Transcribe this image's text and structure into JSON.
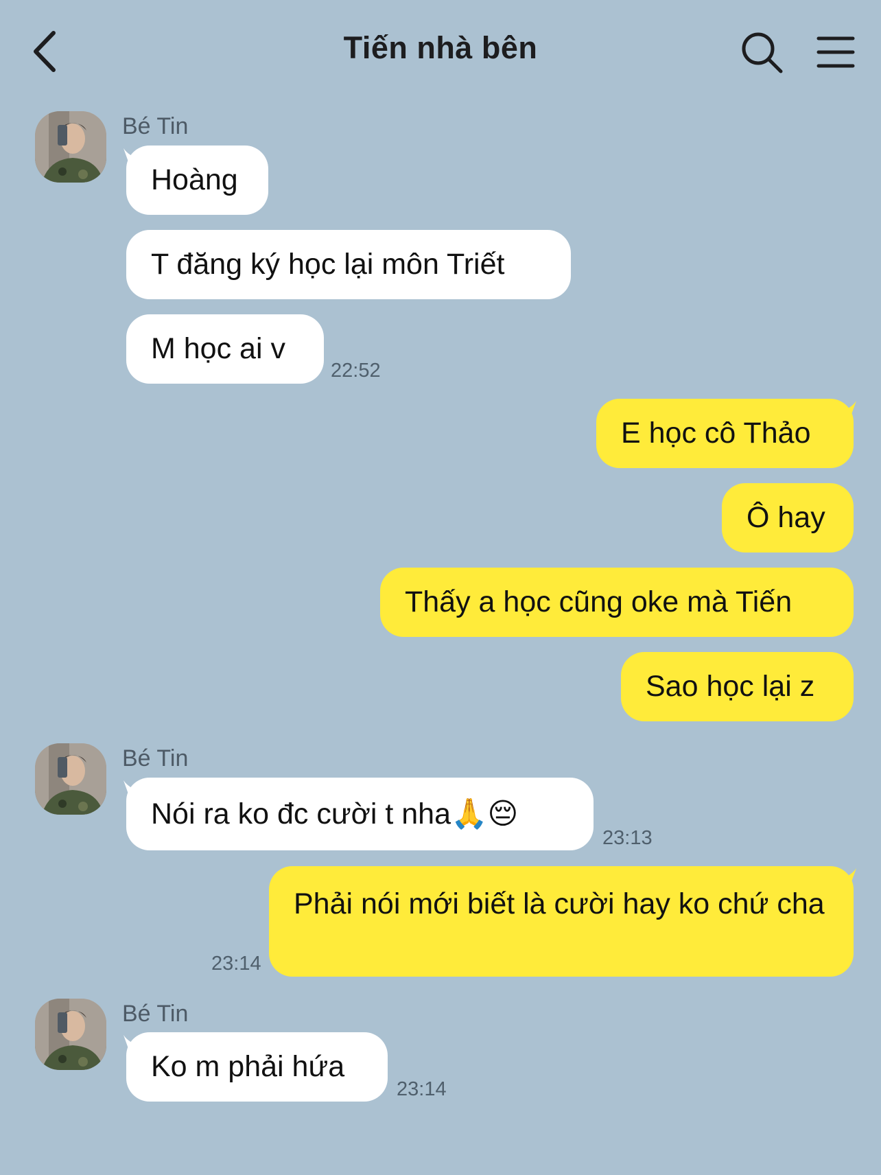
{
  "header": {
    "title": "Tiến nhà bên"
  },
  "messages": [
    {
      "sender": "Bé Tin",
      "text": "Hoàng"
    },
    {
      "text": "T đăng ký học lại môn Triết"
    },
    {
      "text": "M học ai v",
      "time": "22:52"
    },
    {
      "text": "E học cô Thảo"
    },
    {
      "text": "Ô hay"
    },
    {
      "text": "Thấy a học cũng oke mà Tiến"
    },
    {
      "text": "Sao học lại z"
    },
    {
      "sender": "Bé Tin",
      "text": "Nói ra ko đc cười t nha🙏😔",
      "time": "23:13"
    },
    {
      "text": "Phải nói mới biết là cười hay ko chứ cha",
      "time": "23:14"
    },
    {
      "sender": "Bé Tin",
      "text": "Ko m phải hứa",
      "time": "23:14"
    }
  ],
  "colors": {
    "background": "#abc1d1",
    "incoming_bubble": "#ffffff",
    "outgoing_bubble": "#ffeb3a"
  }
}
